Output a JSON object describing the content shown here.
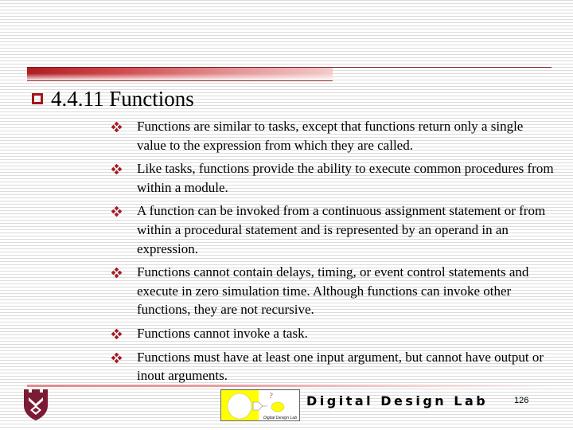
{
  "slide": {
    "heading": "4.4.11 Functions",
    "bullets": [
      {
        "text": "Functions are similar to tasks, except that functions return only a single value to the expression from which they are called."
      },
      {
        "text": "Like tasks, functions provide the ability to execute common procedures from within a module."
      },
      {
        "text": "A function can be invoked from a continuous assignment statement or from within a procedural statement and is represented by an operand in an expression."
      },
      {
        "text": "Functions cannot contain delays, timing, or event control statements and execute in zero simulation time. Although functions can invoke other functions, they are not recursive."
      },
      {
        "text": "Functions cannot invoke a task."
      },
      {
        "text": "Functions must have at least one input argument, but cannot have output or inout arguments."
      }
    ]
  },
  "footer": {
    "logo_caption": "Digital Design Lab",
    "logo_question_mark": "?",
    "lab_name": "Digital Design Lab",
    "page_number": "126"
  },
  "icons": {
    "heading_bullet": "hollow-square-icon",
    "item_bullet": "four-diamond-bullet-icon",
    "university_logo": "shield-crest-icon"
  },
  "colors": {
    "accent_red": "#a5161c",
    "bullet_red": "#a51c24",
    "shield_maroon": "#7b1b34",
    "logo_yellow": "#ffff00"
  }
}
